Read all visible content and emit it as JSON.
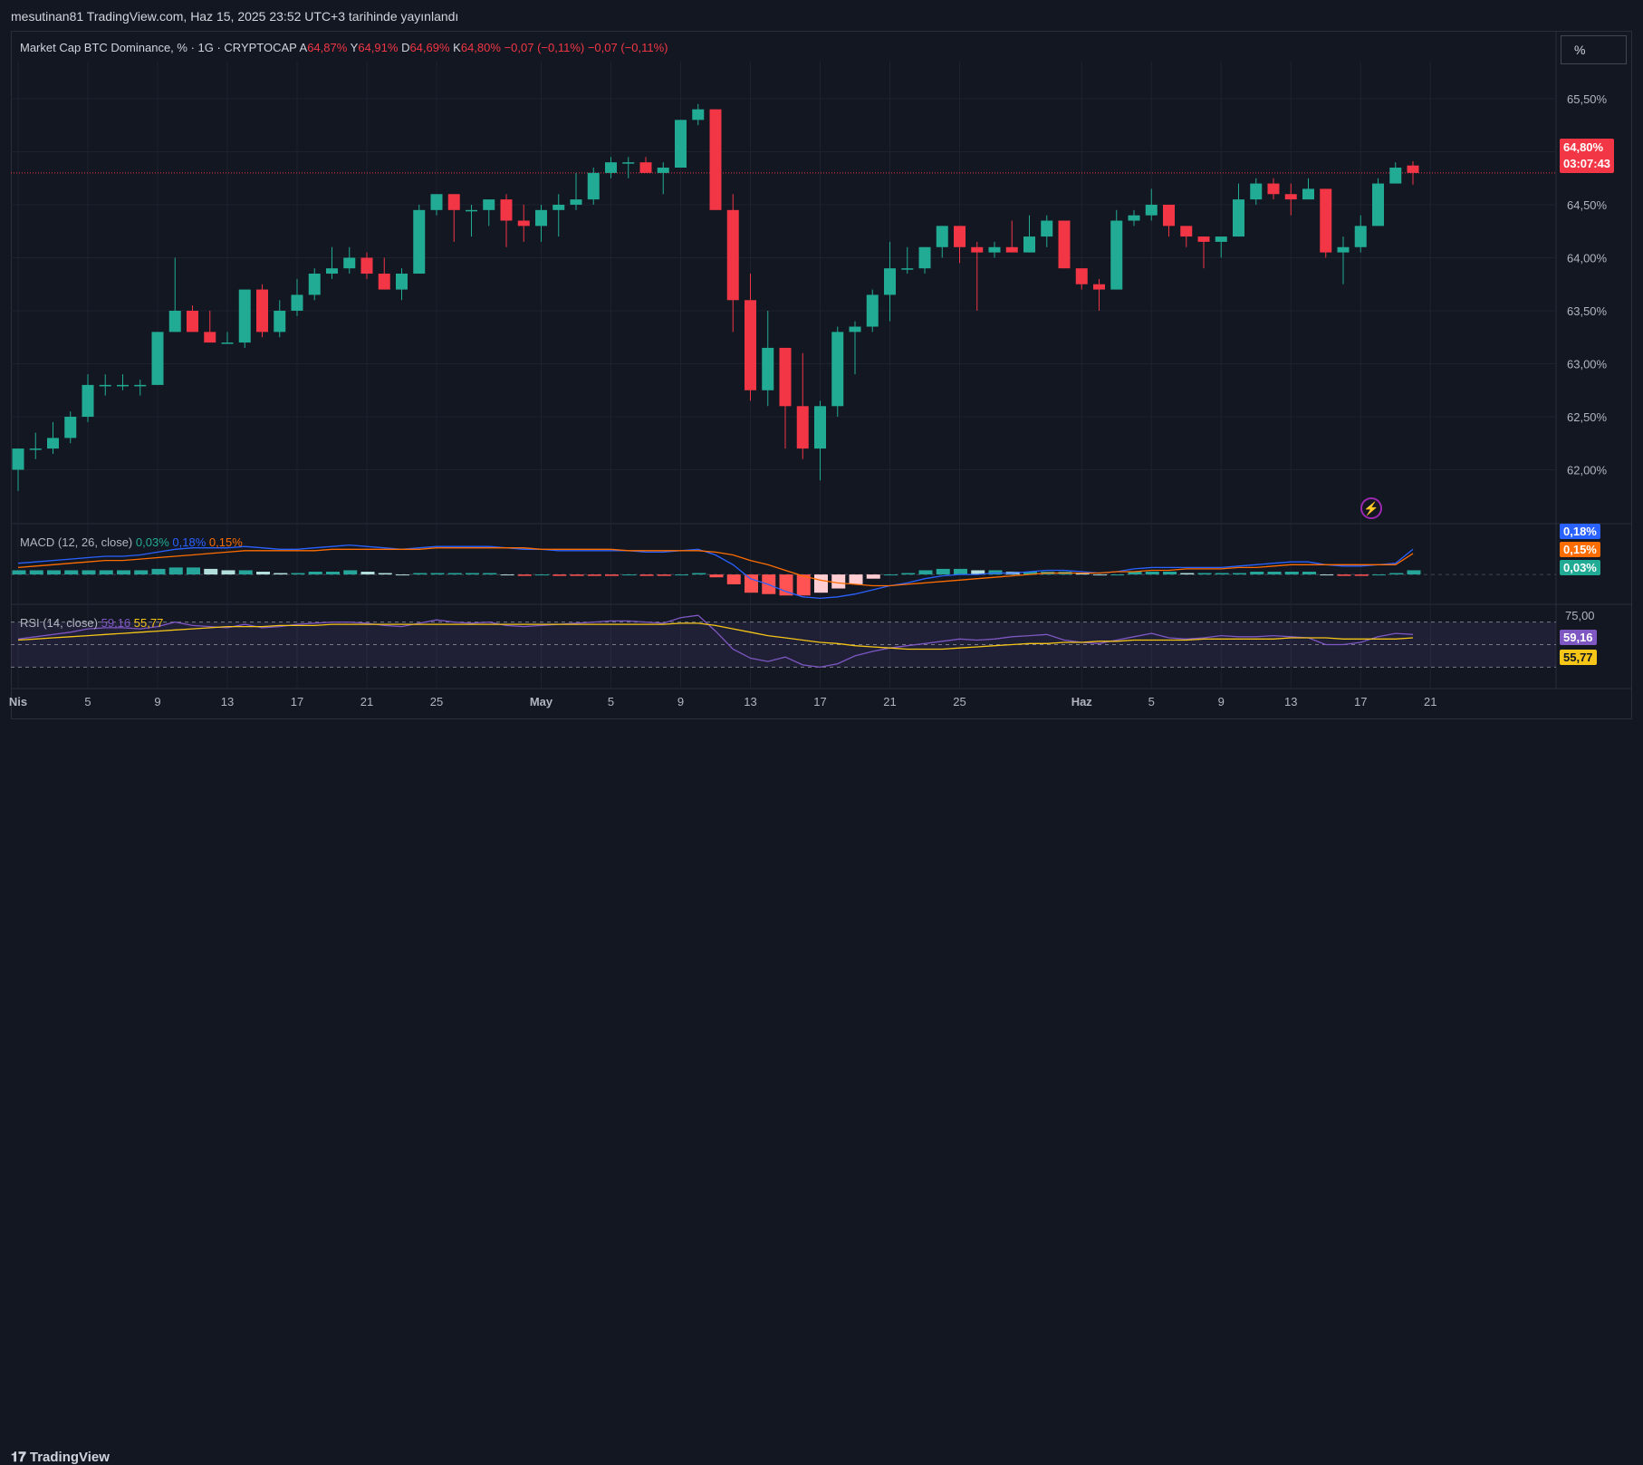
{
  "header": {
    "published": "mesutinan81 TradingView.com, Haz 15, 2025 23:52 UTC+3 tarihinde yayınlandı",
    "scale_button": "%"
  },
  "legend": {
    "symbol": "Market Cap BTC Dominance, % · 1G · CRYPTOCAP",
    "open_label": "A",
    "open": "64,87%",
    "high_label": "Y",
    "high": "64,91%",
    "low_label": "D",
    "low": "64,69%",
    "close_label": "K",
    "close": "64,80%",
    "change": "−0,07 (−0,11%)",
    "change2": "−0,07 (−0,11%)"
  },
  "macd_legend": {
    "title": "MACD (12, 26, close)",
    "hist": "0,03%",
    "macd": "0,18%",
    "signal": "0,15%"
  },
  "rsi_legend": {
    "title": "RSI (14, close)",
    "rsi": "59,16",
    "ma": "55,77"
  },
  "badges": {
    "price": "64,80%",
    "countdown": "03:07:43",
    "macd": "0,18%",
    "signal": "0,15%",
    "hist": "0,03%",
    "rsi_top": "75,00",
    "rsi": "59,16",
    "rsi_ma": "55,77"
  },
  "footer": {
    "brand": "TradingView"
  },
  "colors": {
    "up": "#22ab94",
    "down": "#f23645",
    "macd": "#2962ff",
    "signal": "#ff6d00",
    "rsi": "#7e57c2",
    "rsi_ma": "#f5c518",
    "bg": "#131722"
  },
  "chart_data": {
    "type": "candlestick",
    "title": "Market Cap BTC Dominance, % · 1G · CRYPTOCAP",
    "y_unit": "%",
    "y_ticks": [
      "62,00%",
      "62,50%",
      "63,00%",
      "63,50%",
      "64,00%",
      "64,50%",
      "65,00%",
      "65,50%"
    ],
    "y_tick_values": [
      62.0,
      62.5,
      63.0,
      63.5,
      64.0,
      64.5,
      65.0,
      65.5
    ],
    "ylim": [
      61.5,
      65.85
    ],
    "x_ticks": [
      "Nis",
      "5",
      "9",
      "13",
      "17",
      "21",
      "25",
      "May",
      "5",
      "9",
      "13",
      "17",
      "21",
      "25",
      "Haz",
      "5",
      "9",
      "13",
      "17",
      "21"
    ],
    "x_tick_days": [
      0,
      4,
      8,
      12,
      16,
      20,
      24,
      30,
      34,
      38,
      42,
      46,
      50,
      54,
      61,
      65,
      69,
      73,
      77,
      81
    ],
    "last_price": 64.8,
    "candles": [
      {
        "o": 62.0,
        "h": 62.2,
        "l": 61.8,
        "c": 62.2
      },
      {
        "o": 62.2,
        "h": 62.35,
        "l": 62.1,
        "c": 62.2
      },
      {
        "o": 62.2,
        "h": 62.45,
        "l": 62.15,
        "c": 62.3
      },
      {
        "o": 62.3,
        "h": 62.55,
        "l": 62.25,
        "c": 62.5
      },
      {
        "o": 62.5,
        "h": 62.9,
        "l": 62.45,
        "c": 62.8
      },
      {
        "o": 62.8,
        "h": 62.9,
        "l": 62.7,
        "c": 62.8
      },
      {
        "o": 62.8,
        "h": 62.9,
        "l": 62.75,
        "c": 62.8
      },
      {
        "o": 62.8,
        "h": 62.85,
        "l": 62.7,
        "c": 62.8
      },
      {
        "o": 62.8,
        "h": 63.3,
        "l": 62.8,
        "c": 63.3
      },
      {
        "o": 63.3,
        "h": 64.0,
        "l": 63.3,
        "c": 63.5
      },
      {
        "o": 63.5,
        "h": 63.55,
        "l": 63.35,
        "c": 63.3
      },
      {
        "o": 63.3,
        "h": 63.5,
        "l": 63.2,
        "c": 63.2
      },
      {
        "o": 63.2,
        "h": 63.3,
        "l": 63.2,
        "c": 63.2
      },
      {
        "o": 63.2,
        "h": 63.7,
        "l": 63.15,
        "c": 63.7
      },
      {
        "o": 63.7,
        "h": 63.75,
        "l": 63.25,
        "c": 63.3
      },
      {
        "o": 63.3,
        "h": 63.6,
        "l": 63.25,
        "c": 63.5
      },
      {
        "o": 63.5,
        "h": 63.8,
        "l": 63.45,
        "c": 63.65
      },
      {
        "o": 63.65,
        "h": 63.9,
        "l": 63.6,
        "c": 63.85
      },
      {
        "o": 63.85,
        "h": 64.1,
        "l": 63.8,
        "c": 63.9
      },
      {
        "o": 63.9,
        "h": 64.1,
        "l": 63.85,
        "c": 64.0
      },
      {
        "o": 64.0,
        "h": 64.05,
        "l": 63.8,
        "c": 63.85
      },
      {
        "o": 63.85,
        "h": 64.0,
        "l": 63.7,
        "c": 63.7
      },
      {
        "o": 63.7,
        "h": 63.9,
        "l": 63.6,
        "c": 63.85
      },
      {
        "o": 63.85,
        "h": 64.5,
        "l": 63.85,
        "c": 64.45
      },
      {
        "o": 64.45,
        "h": 64.6,
        "l": 64.4,
        "c": 64.6
      },
      {
        "o": 64.6,
        "h": 64.6,
        "l": 64.15,
        "c": 64.45
      },
      {
        "o": 64.45,
        "h": 64.5,
        "l": 64.2,
        "c": 64.45
      },
      {
        "o": 64.45,
        "h": 64.55,
        "l": 64.3,
        "c": 64.55
      },
      {
        "o": 64.55,
        "h": 64.6,
        "l": 64.1,
        "c": 64.35
      },
      {
        "o": 64.35,
        "h": 64.5,
        "l": 64.15,
        "c": 64.3
      },
      {
        "o": 64.3,
        "h": 64.5,
        "l": 64.15,
        "c": 64.45
      },
      {
        "o": 64.45,
        "h": 64.6,
        "l": 64.2,
        "c": 64.5
      },
      {
        "o": 64.5,
        "h": 64.8,
        "l": 64.45,
        "c": 64.55
      },
      {
        "o": 64.55,
        "h": 64.85,
        "l": 64.5,
        "c": 64.8
      },
      {
        "o": 64.8,
        "h": 64.95,
        "l": 64.75,
        "c": 64.9
      },
      {
        "o": 64.9,
        "h": 64.95,
        "l": 64.75,
        "c": 64.9
      },
      {
        "o": 64.9,
        "h": 64.95,
        "l": 64.8,
        "c": 64.8
      },
      {
        "o": 64.8,
        "h": 64.9,
        "l": 64.6,
        "c": 64.85
      },
      {
        "o": 64.85,
        "h": 65.3,
        "l": 64.85,
        "c": 65.3
      },
      {
        "o": 65.3,
        "h": 65.45,
        "l": 65.25,
        "c": 65.4
      },
      {
        "o": 65.4,
        "h": 65.4,
        "l": 64.45,
        "c": 64.45
      },
      {
        "o": 64.45,
        "h": 64.6,
        "l": 63.3,
        "c": 63.6
      },
      {
        "o": 63.6,
        "h": 63.85,
        "l": 62.65,
        "c": 62.75
      },
      {
        "o": 62.75,
        "h": 63.5,
        "l": 62.6,
        "c": 63.15
      },
      {
        "o": 63.15,
        "h": 63.15,
        "l": 62.2,
        "c": 62.6
      },
      {
        "o": 62.6,
        "h": 63.1,
        "l": 62.1,
        "c": 62.2
      },
      {
        "o": 62.2,
        "h": 62.65,
        "l": 61.9,
        "c": 62.6
      },
      {
        "o": 62.6,
        "h": 63.35,
        "l": 62.5,
        "c": 63.3
      },
      {
        "o": 63.3,
        "h": 63.4,
        "l": 62.9,
        "c": 63.35
      },
      {
        "o": 63.35,
        "h": 63.7,
        "l": 63.3,
        "c": 63.65
      },
      {
        "o": 63.65,
        "h": 64.15,
        "l": 63.4,
        "c": 63.9
      },
      {
        "o": 63.9,
        "h": 64.1,
        "l": 63.85,
        "c": 63.9
      },
      {
        "o": 63.9,
        "h": 64.1,
        "l": 63.85,
        "c": 64.1
      },
      {
        "o": 64.1,
        "h": 64.3,
        "l": 64.0,
        "c": 64.3
      },
      {
        "o": 64.3,
        "h": 64.3,
        "l": 63.95,
        "c": 64.1
      },
      {
        "o": 64.1,
        "h": 64.15,
        "l": 63.5,
        "c": 64.05
      },
      {
        "o": 64.05,
        "h": 64.15,
        "l": 64.0,
        "c": 64.1
      },
      {
        "o": 64.1,
        "h": 64.35,
        "l": 64.05,
        "c": 64.05
      },
      {
        "o": 64.05,
        "h": 64.4,
        "l": 64.05,
        "c": 64.2
      },
      {
        "o": 64.2,
        "h": 64.4,
        "l": 64.1,
        "c": 64.35
      },
      {
        "o": 64.35,
        "h": 64.35,
        "l": 63.9,
        "c": 63.9
      },
      {
        "o": 63.9,
        "h": 63.9,
        "l": 63.7,
        "c": 63.75
      },
      {
        "o": 63.75,
        "h": 63.8,
        "l": 63.5,
        "c": 63.7
      },
      {
        "o": 63.7,
        "h": 64.45,
        "l": 63.7,
        "c": 64.35
      },
      {
        "o": 64.35,
        "h": 64.45,
        "l": 64.3,
        "c": 64.4
      },
      {
        "o": 64.4,
        "h": 64.65,
        "l": 64.35,
        "c": 64.5
      },
      {
        "o": 64.5,
        "h": 64.5,
        "l": 64.2,
        "c": 64.3
      },
      {
        "o": 64.3,
        "h": 64.3,
        "l": 64.1,
        "c": 64.2
      },
      {
        "o": 64.2,
        "h": 64.2,
        "l": 63.9,
        "c": 64.15
      },
      {
        "o": 64.15,
        "h": 64.15,
        "l": 64.0,
        "c": 64.2
      },
      {
        "o": 64.2,
        "h": 64.7,
        "l": 64.2,
        "c": 64.55
      },
      {
        "o": 64.55,
        "h": 64.75,
        "l": 64.5,
        "c": 64.7
      },
      {
        "o": 64.7,
        "h": 64.75,
        "l": 64.55,
        "c": 64.6
      },
      {
        "o": 64.6,
        "h": 64.7,
        "l": 64.4,
        "c": 64.55
      },
      {
        "o": 64.55,
        "h": 64.75,
        "l": 64.55,
        "c": 64.65
      },
      {
        "o": 64.65,
        "h": 64.65,
        "l": 64.0,
        "c": 64.05
      },
      {
        "o": 64.05,
        "h": 64.2,
        "l": 63.75,
        "c": 64.1
      },
      {
        "o": 64.1,
        "h": 64.4,
        "l": 64.05,
        "c": 64.3
      },
      {
        "o": 64.3,
        "h": 64.75,
        "l": 64.3,
        "c": 64.7
      },
      {
        "o": 64.7,
        "h": 64.9,
        "l": 64.7,
        "c": 64.85
      },
      {
        "o": 64.87,
        "h": 64.91,
        "l": 64.69,
        "c": 64.8
      }
    ],
    "macd": {
      "ylim": [
        -0.2,
        0.35
      ],
      "macd_line": [
        0.08,
        0.09,
        0.1,
        0.11,
        0.12,
        0.13,
        0.13,
        0.14,
        0.16,
        0.18,
        0.19,
        0.19,
        0.19,
        0.2,
        0.19,
        0.18,
        0.18,
        0.19,
        0.2,
        0.21,
        0.2,
        0.19,
        0.18,
        0.19,
        0.2,
        0.2,
        0.2,
        0.2,
        0.19,
        0.18,
        0.18,
        0.17,
        0.17,
        0.17,
        0.17,
        0.17,
        0.16,
        0.16,
        0.17,
        0.18,
        0.14,
        0.07,
        -0.03,
        -0.07,
        -0.12,
        -0.16,
        -0.17,
        -0.16,
        -0.14,
        -0.11,
        -0.08,
        -0.06,
        -0.03,
        -0.01,
        0.0,
        0.0,
        0.01,
        0.01,
        0.02,
        0.03,
        0.03,
        0.02,
        0.01,
        0.02,
        0.04,
        0.05,
        0.05,
        0.05,
        0.05,
        0.05,
        0.06,
        0.07,
        0.08,
        0.09,
        0.09,
        0.07,
        0.06,
        0.06,
        0.07,
        0.08,
        0.18
      ],
      "signal_line": [
        0.05,
        0.06,
        0.07,
        0.08,
        0.09,
        0.1,
        0.1,
        0.11,
        0.12,
        0.13,
        0.14,
        0.15,
        0.16,
        0.17,
        0.17,
        0.17,
        0.17,
        0.17,
        0.18,
        0.18,
        0.18,
        0.18,
        0.18,
        0.18,
        0.19,
        0.19,
        0.19,
        0.19,
        0.19,
        0.19,
        0.18,
        0.18,
        0.18,
        0.18,
        0.18,
        0.17,
        0.17,
        0.17,
        0.17,
        0.17,
        0.16,
        0.14,
        0.1,
        0.07,
        0.03,
        -0.01,
        -0.04,
        -0.06,
        -0.07,
        -0.08,
        -0.08,
        -0.07,
        -0.06,
        -0.05,
        -0.04,
        -0.03,
        -0.02,
        -0.01,
        0.0,
        0.01,
        0.01,
        0.01,
        0.01,
        0.02,
        0.02,
        0.03,
        0.03,
        0.04,
        0.04,
        0.04,
        0.05,
        0.05,
        0.06,
        0.07,
        0.07,
        0.07,
        0.07,
        0.07,
        0.07,
        0.07,
        0.15
      ],
      "histogram": [
        0.03,
        0.03,
        0.03,
        0.03,
        0.03,
        0.03,
        0.03,
        0.03,
        0.04,
        0.05,
        0.05,
        0.04,
        0.03,
        0.03,
        0.02,
        0.01,
        0.01,
        0.02,
        0.02,
        0.03,
        0.02,
        0.01,
        0.0,
        0.01,
        0.01,
        0.01,
        0.01,
        0.01,
        0.0,
        -0.01,
        0.0,
        -0.01,
        -0.01,
        -0.01,
        -0.01,
        0.0,
        -0.01,
        -0.01,
        0.0,
        0.01,
        -0.02,
        -0.07,
        -0.13,
        -0.14,
        -0.15,
        -0.15,
        -0.13,
        -0.1,
        -0.07,
        -0.03,
        0.0,
        0.01,
        0.03,
        0.04,
        0.04,
        0.03,
        0.03,
        0.02,
        0.02,
        0.02,
        0.02,
        0.01,
        0.0,
        0.0,
        0.02,
        0.02,
        0.02,
        0.01,
        0.01,
        0.01,
        0.01,
        0.02,
        0.02,
        0.02,
        0.02,
        0.0,
        -0.01,
        -0.01,
        0.0,
        0.01,
        0.03
      ]
    },
    "rsi": {
      "ylim": [
        15,
        85
      ],
      "levels": [
        70,
        50,
        30
      ],
      "rsi_line": [
        55,
        57,
        59,
        61,
        64,
        65,
        65,
        64,
        66,
        70,
        67,
        66,
        65,
        68,
        65,
        66,
        68,
        69,
        70,
        70,
        69,
        67,
        66,
        69,
        72,
        70,
        69,
        70,
        67,
        66,
        67,
        68,
        69,
        70,
        71,
        71,
        70,
        69,
        74,
        76,
        62,
        46,
        38,
        35,
        39,
        32,
        30,
        33,
        40,
        44,
        47,
        49,
        51,
        53,
        55,
        54,
        55,
        57,
        58,
        59,
        54,
        52,
        51,
        54,
        57,
        60,
        56,
        55,
        56,
        58,
        57,
        57,
        58,
        57,
        56,
        50,
        50,
        52,
        57,
        60,
        59
      ],
      "ma_line": [
        54,
        55,
        56,
        57,
        58,
        59,
        60,
        61,
        62,
        63,
        64,
        65,
        66,
        66,
        66,
        67,
        67,
        67,
        68,
        68,
        68,
        68,
        68,
        68,
        68,
        68,
        68,
        68,
        68,
        68,
        68,
        68,
        68,
        68,
        68,
        68,
        68,
        68,
        69,
        69,
        67,
        64,
        61,
        58,
        56,
        54,
        52,
        51,
        49,
        48,
        47,
        46,
        46,
        46,
        47,
        48,
        49,
        50,
        51,
        51,
        52,
        52,
        53,
        53,
        54,
        54,
        54,
        54,
        55,
        55,
        55,
        55,
        55,
        56,
        56,
        56,
        55,
        55,
        55,
        55,
        56
      ]
    }
  }
}
